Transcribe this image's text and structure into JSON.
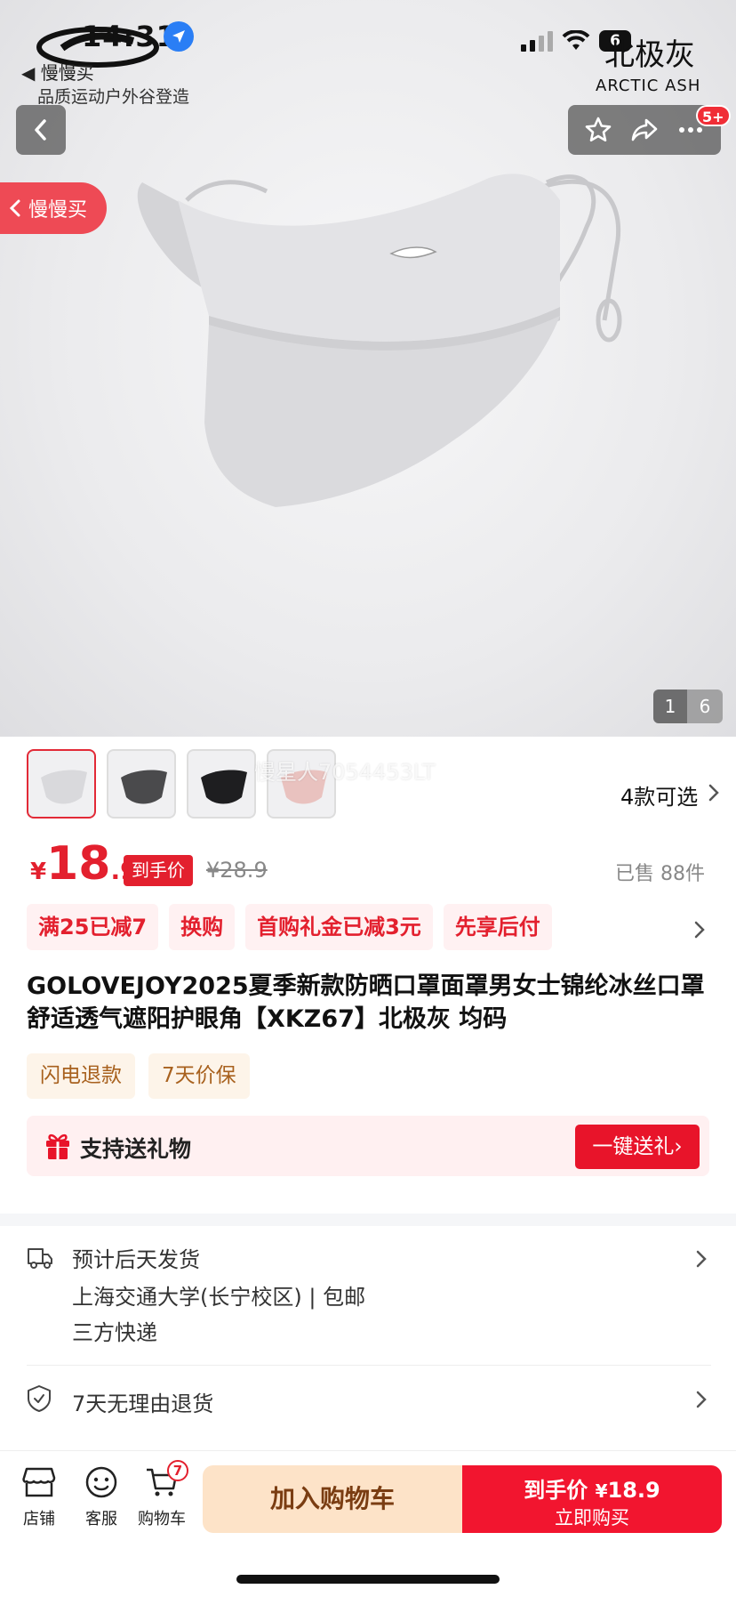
{
  "status_bar": {
    "time": "14:31",
    "battery": "6"
  },
  "brand": {
    "back_link": "◀ 慢慢买",
    "tagline": "品质运动户外谷登造"
  },
  "product_image": {
    "color_name_cn": "北极灰",
    "color_name_en": "ARCTIC ASH",
    "current_index": "1",
    "total": "6"
  },
  "nav": {
    "more_badge": "5+",
    "slow_buy_label": "慢慢买"
  },
  "variants": {
    "watermark": "慢星人7054453LT",
    "count_label": "4款可选",
    "thumb_colors": [
      "#d9d9dc",
      "#4a4a4c",
      "#1e1e20",
      "#e9c2bf"
    ]
  },
  "price": {
    "currency": "¥",
    "integer": "18",
    "decimal": ".9",
    "tag": "到手价",
    "original": "¥28.9",
    "sold": "已售 88件"
  },
  "promos": [
    "满25已减7",
    "换购",
    "首购礼金已减3元",
    "先享后付"
  ],
  "title": "GOLOVEJOY2025夏季新款防晒口罩面罩男女士锦纶冰丝口罩舒适透气遮阳护眼角【XKZ67】北极灰 均码",
  "services": [
    "闪电退款",
    "7天价保"
  ],
  "gift": {
    "label": "支持送礼物",
    "button": "一键送礼›"
  },
  "shipping": {
    "line1": "预计后天发货",
    "line2": "上海交通大学(长宁校区) | 包邮",
    "line3": "三方快递"
  },
  "returns": {
    "label": "7天无理由退货"
  },
  "bottom_bar": {
    "store": "店铺",
    "service": "客服",
    "cart": "购物车",
    "cart_count": "7",
    "add_to_cart": "加入购物车",
    "buy_price_label": "到手价",
    "buy_price_symbol": "¥",
    "buy_price": "18.9",
    "buy_now": "立即购买"
  },
  "colors": {
    "accent_red": "#e3202e",
    "promo_bg": "#fff1f2",
    "service_bg": "#fdf4e9"
  }
}
